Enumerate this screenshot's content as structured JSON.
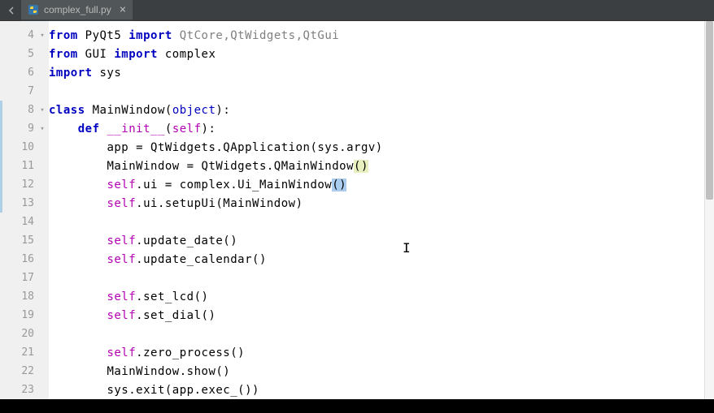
{
  "tab": {
    "filename": "complex_full.py",
    "close_glyph": "×"
  },
  "gutter": {
    "lines": [
      4,
      5,
      6,
      7,
      8,
      9,
      10,
      11,
      12,
      13,
      14,
      15,
      16,
      17,
      18,
      19,
      20,
      21,
      22,
      23
    ]
  },
  "code": {
    "l4": {
      "kw_from": "from",
      "mod1": " PyQt5 ",
      "kw_import": "import",
      "imps": " QtCore,QtWidgets,QtGui"
    },
    "l5": {
      "kw_from": "from",
      "mod1": " GUI ",
      "kw_import": "import",
      "imps": " complex"
    },
    "l6": {
      "kw_import": "import",
      "mod": " sys"
    },
    "l8": {
      "kw_class": "class",
      "name": " MainWindow(",
      "obj": "object",
      "close": "):"
    },
    "l9": {
      "kw_def": "def",
      "sp": " ",
      "dunder": "__init__",
      "rest_open": "(",
      "self": "self",
      "rest_close": "):"
    },
    "l10": {
      "txt1": "app = QtWidgets.QApplication(sys.argv)"
    },
    "l11": {
      "txt1": "MainWindow = QtWidgets.QMainWindow",
      "p1": "(",
      "p2": ")"
    },
    "l12": {
      "self": "self",
      "txt1": ".ui = complex.Ui_MainWindow",
      "p1": "(",
      "p2": ")"
    },
    "l13": {
      "self": "self",
      "txt1": ".ui.setupUi(MainWindow)"
    },
    "l15": {
      "self": "self",
      "txt1": ".update_date()"
    },
    "l16": {
      "self": "self",
      "txt1": ".update_calendar()"
    },
    "l18": {
      "self": "self",
      "txt1": ".set_lcd()"
    },
    "l19": {
      "self": "self",
      "txt1": ".set_dial()"
    },
    "l21": {
      "self": "self",
      "txt1": ".zero_process()"
    },
    "l22": {
      "txt1": "MainWindow.show()"
    },
    "l23": {
      "txt1": "sys.exit(app.exec_())"
    }
  },
  "indent": {
    "i1": "    ",
    "i2": "        "
  }
}
